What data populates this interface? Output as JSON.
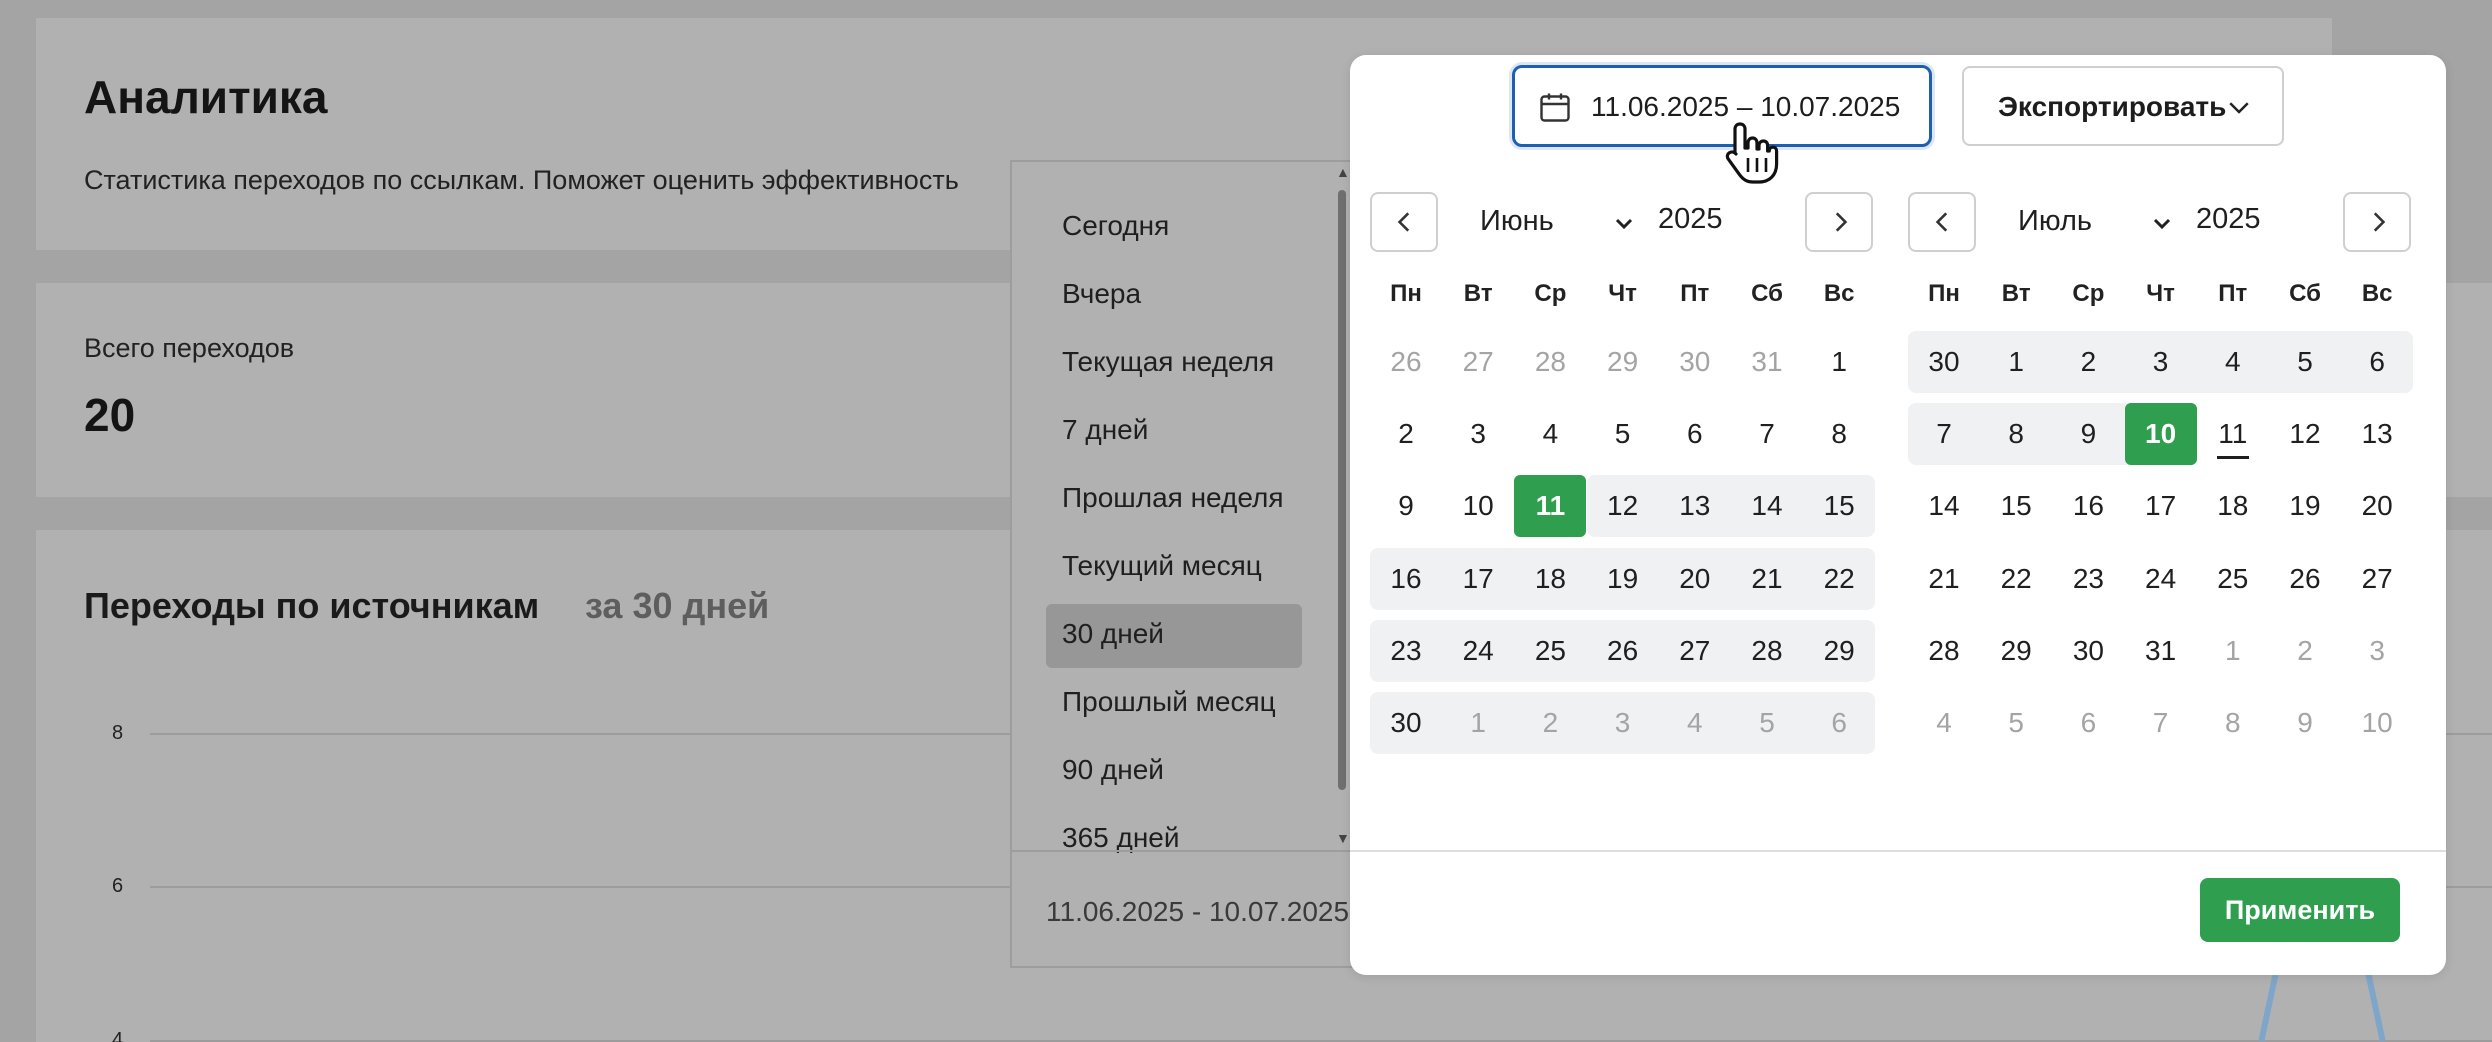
{
  "page": {
    "title": "Аналитика",
    "description": "Статистика переходов по ссылкам. Поможет оценить эффективность",
    "total_label": "Всего переходов",
    "total_value": "20",
    "sources_title": "Переходы по источникам",
    "sources_period": "за 30 дней",
    "chart_ticks": [
      "8",
      "6",
      "4"
    ]
  },
  "toolbar": {
    "date_range": "11.06.2025 – 10.07.2025",
    "export_label": "Экспортировать",
    "calendar_icon": "calendar-icon",
    "export_chevron_icon": "chevron-down-icon"
  },
  "presets": {
    "items": [
      "Сегодня",
      "Вчера",
      "Текущая неделя",
      "7 дней",
      "Прошлая неделя",
      "Текущий месяц",
      "30 дней",
      "Прошлый месяц",
      "90 дней",
      "365 дней"
    ],
    "active": "30 дней",
    "range_text": "11.06.2025 - 10.07.2025"
  },
  "weekdays": [
    "Пн",
    "Вт",
    "Ср",
    "Чт",
    "Пт",
    "Сб",
    "Вс"
  ],
  "calendars": [
    {
      "month": "Июнь",
      "year": "2025",
      "weeks": [
        [
          "26",
          "27",
          "28",
          "29",
          "30",
          "31",
          "1"
        ],
        [
          "2",
          "3",
          "4",
          "5",
          "6",
          "7",
          "8"
        ],
        [
          "9",
          "10",
          "11",
          "12",
          "13",
          "14",
          "15"
        ],
        [
          "16",
          "17",
          "18",
          "19",
          "20",
          "21",
          "22"
        ],
        [
          "23",
          "24",
          "25",
          "26",
          "27",
          "28",
          "29"
        ],
        [
          "30",
          "1",
          "2",
          "3",
          "4",
          "5",
          "6"
        ]
      ]
    },
    {
      "month": "Июль",
      "year": "2025",
      "weeks": [
        [
          "30",
          "1",
          "2",
          "3",
          "4",
          "5",
          "6"
        ],
        [
          "7",
          "8",
          "9",
          "10",
          "11",
          "12",
          "13"
        ],
        [
          "14",
          "15",
          "16",
          "17",
          "18",
          "19",
          "20"
        ],
        [
          "21",
          "22",
          "23",
          "24",
          "25",
          "26",
          "27"
        ],
        [
          "28",
          "29",
          "30",
          "31",
          "1",
          "2",
          "3"
        ],
        [
          "4",
          "5",
          "6",
          "7",
          "8",
          "9",
          "10"
        ]
      ]
    }
  ],
  "apply_label": "Применить",
  "colors": {
    "accent_green": "#2f9e4f",
    "focus_blue": "#1f5fb0",
    "range_band": "#eff1f3"
  }
}
